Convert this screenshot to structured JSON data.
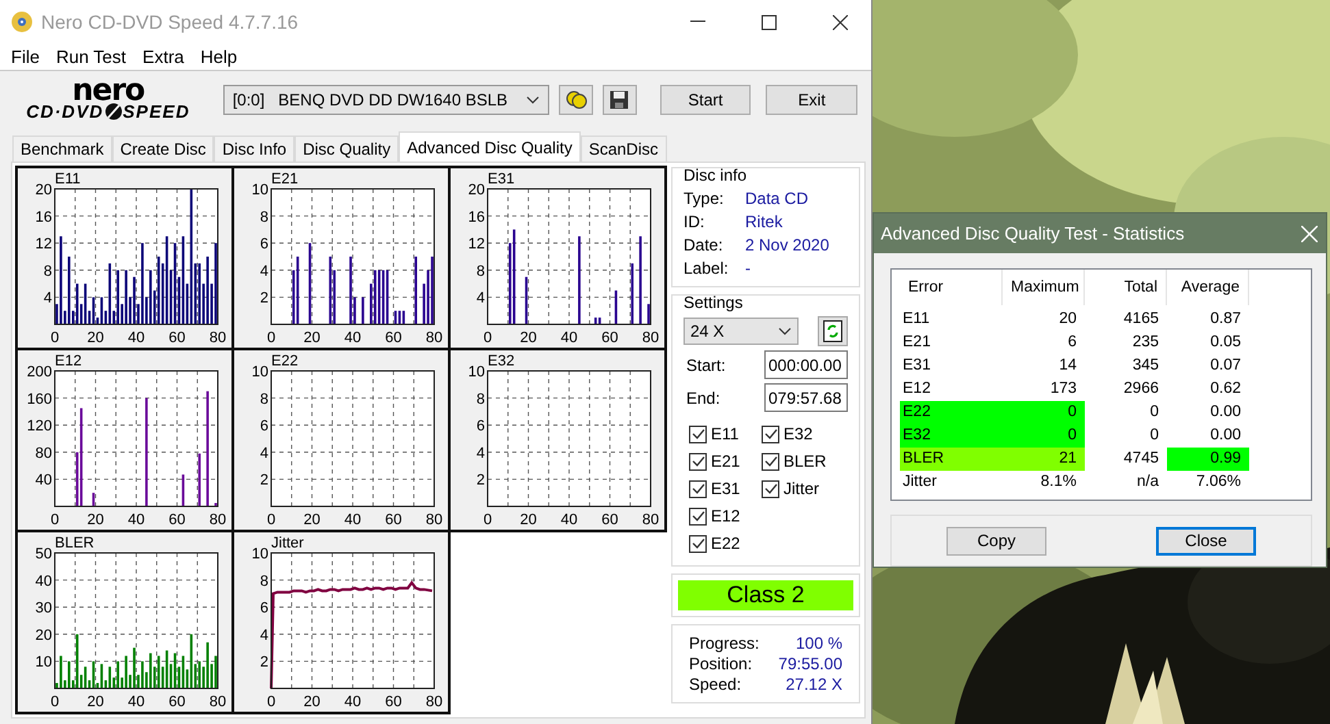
{
  "window": {
    "title": "Nero CD-DVD Speed 4.7.7.16"
  },
  "menu": [
    "File",
    "Run Test",
    "Extra",
    "Help"
  ],
  "toolbar": {
    "logo": {
      "top": "nero",
      "left": "CD·DVD",
      "right": "SPEED"
    },
    "drive": "[0:0]   BENQ DVD DD DW1640 BSLB",
    "buttons": [
      "Start",
      "Exit"
    ]
  },
  "tabs": [
    {
      "label": "Benchmark",
      "selected": false
    },
    {
      "label": "Create Disc",
      "selected": false
    },
    {
      "label": "Disc Info",
      "selected": false
    },
    {
      "label": "Disc Quality",
      "selected": false
    },
    {
      "label": "Advanced Disc Quality",
      "selected": true
    },
    {
      "label": "ScanDisc",
      "selected": false
    }
  ],
  "charts": [
    {
      "chart_data": {
        "type": "bar",
        "title": "E11",
        "grid": true,
        "x": [
          1,
          3,
          5,
          7,
          9,
          11,
          13,
          15,
          17,
          19,
          21,
          23,
          25,
          27,
          29,
          31,
          33,
          35,
          37,
          39,
          41,
          43,
          45,
          47,
          49,
          51,
          53,
          55,
          57,
          59,
          61,
          63,
          65,
          67,
          69,
          71,
          73,
          75,
          77,
          79
        ],
        "xlim": [
          0,
          80
        ],
        "ylim": [
          0,
          20
        ],
        "xticks": [
          0,
          20,
          40,
          60,
          80
        ],
        "yticks": [
          4,
          8,
          12,
          16,
          20
        ],
        "series": [
          {
            "color": "#0c0478",
            "values": [
              3,
              13,
              2,
              10,
              2,
              6,
              3,
              6,
              2,
              4,
              1,
              4,
              2,
              9,
              2,
              8,
              3,
              8,
              4,
              7,
              3,
              12,
              4,
              8,
              5,
              10,
              9,
              13,
              8,
              12,
              7,
              13,
              6,
              20,
              9,
              9,
              6,
              10,
              6,
              12
            ]
          }
        ]
      }
    },
    {
      "chart_data": {
        "type": "bar",
        "title": "E21",
        "grid": true,
        "x": [
          1,
          3,
          5,
          7,
          9,
          11,
          13,
          15,
          17,
          19,
          21,
          23,
          25,
          27,
          29,
          31,
          33,
          35,
          37,
          39,
          41,
          43,
          45,
          47,
          49,
          51,
          53,
          55,
          57,
          59,
          61,
          63,
          65,
          67,
          69,
          71,
          73,
          75,
          77,
          79
        ],
        "xlim": [
          0,
          80
        ],
        "ylim": [
          0,
          10
        ],
        "xticks": [
          0,
          20,
          40,
          60,
          80
        ],
        "yticks": [
          2,
          4,
          6,
          8,
          10
        ],
        "series": [
          {
            "color": "#2a0490",
            "values": [
              0,
              0,
              0,
              0,
              0,
              4,
              5,
              0,
              0,
              6,
              0,
              0,
              0,
              0,
              5,
              4,
              0,
              0,
              0,
              5,
              2,
              0,
              2,
              0,
              3,
              4,
              4,
              4,
              4,
              0,
              1,
              1,
              1,
              0,
              0,
              5,
              0,
              3,
              4,
              5
            ]
          }
        ]
      }
    },
    {
      "chart_data": {
        "type": "bar",
        "title": "E31",
        "grid": true,
        "x": [
          1,
          3,
          5,
          7,
          9,
          11,
          13,
          15,
          17,
          19,
          21,
          23,
          25,
          27,
          29,
          31,
          33,
          35,
          37,
          39,
          41,
          43,
          45,
          47,
          49,
          51,
          53,
          55,
          57,
          59,
          61,
          63,
          65,
          67,
          69,
          71,
          73,
          75,
          77,
          79
        ],
        "xlim": [
          0,
          80
        ],
        "ylim": [
          0,
          20
        ],
        "xticks": [
          0,
          20,
          40,
          60,
          80
        ],
        "yticks": [
          4,
          8,
          12,
          16,
          20
        ],
        "series": [
          {
            "color": "#2a0490",
            "values": [
              0,
              0,
              0,
              0,
              0,
              12,
              14,
              0,
              0,
              7,
              0,
              0,
              0,
              0,
              0,
              0,
              0,
              0,
              0,
              0,
              0,
              0,
              13,
              0,
              0,
              0,
              1,
              1,
              0,
              0,
              0,
              5,
              0,
              0,
              0,
              9,
              0,
              13,
              0,
              3
            ]
          }
        ]
      }
    },
    {
      "chart_data": {
        "type": "bar",
        "title": "E12",
        "grid": true,
        "x": [
          1,
          3,
          5,
          7,
          9,
          11,
          13,
          15,
          17,
          19,
          21,
          23,
          25,
          27,
          29,
          31,
          33,
          35,
          37,
          39,
          41,
          43,
          45,
          47,
          49,
          51,
          53,
          55,
          57,
          59,
          61,
          63,
          65,
          67,
          69,
          71,
          73,
          75,
          77,
          79
        ],
        "xlim": [
          0,
          80
        ],
        "ylim": [
          0,
          200
        ],
        "xticks": [
          0,
          20,
          40,
          60,
          80
        ],
        "yticks": [
          40,
          80,
          120,
          160,
          200
        ],
        "series": [
          {
            "color": "#6a0a9a",
            "values": [
              0,
              0,
              0,
              0,
              0,
              80,
              145,
              0,
              0,
              20,
              0,
              0,
              0,
              0,
              0,
              0,
              0,
              0,
              0,
              0,
              0,
              0,
              160,
              0,
              0,
              0,
              0,
              0,
              0,
              0,
              0,
              47,
              0,
              0,
              0,
              78,
              0,
              170,
              0,
              5
            ]
          }
        ]
      }
    },
    {
      "chart_data": {
        "type": "bar",
        "title": "E22",
        "grid": true,
        "x": [
          1,
          3,
          5,
          7,
          9,
          11,
          13,
          15,
          17,
          19,
          21,
          23,
          25,
          27,
          29,
          31,
          33,
          35,
          37,
          39,
          41,
          43,
          45,
          47,
          49,
          51,
          53,
          55,
          57,
          59,
          61,
          63,
          65,
          67,
          69,
          71,
          73,
          75,
          77,
          79
        ],
        "xlim": [
          0,
          80
        ],
        "ylim": [
          0,
          10
        ],
        "xticks": [
          0,
          20,
          40,
          60,
          80
        ],
        "yticks": [
          2,
          4,
          6,
          8,
          10
        ],
        "series": [
          {
            "values": [
              0,
              0,
              0,
              0,
              0,
              0,
              0,
              0,
              0,
              0,
              0,
              0,
              0,
              0,
              0,
              0,
              0,
              0,
              0,
              0,
              0,
              0,
              0,
              0,
              0,
              0,
              0,
              0,
              0,
              0,
              0,
              0,
              0,
              0,
              0,
              0,
              0,
              0,
              0,
              0
            ]
          }
        ]
      }
    },
    {
      "chart_data": {
        "type": "bar",
        "title": "E32",
        "grid": true,
        "x": [
          1,
          3,
          5,
          7,
          9,
          11,
          13,
          15,
          17,
          19,
          21,
          23,
          25,
          27,
          29,
          31,
          33,
          35,
          37,
          39,
          41,
          43,
          45,
          47,
          49,
          51,
          53,
          55,
          57,
          59,
          61,
          63,
          65,
          67,
          69,
          71,
          73,
          75,
          77,
          79
        ],
        "xlim": [
          0,
          80
        ],
        "ylim": [
          0,
          10
        ],
        "xticks": [
          0,
          20,
          40,
          60,
          80
        ],
        "yticks": [
          2,
          4,
          6,
          8,
          10
        ],
        "series": [
          {
            "values": [
              0,
              0,
              0,
              0,
              0,
              0,
              0,
              0,
              0,
              0,
              0,
              0,
              0,
              0,
              0,
              0,
              0,
              0,
              0,
              0,
              0,
              0,
              0,
              0,
              0,
              0,
              0,
              0,
              0,
              0,
              0,
              0,
              0,
              0,
              0,
              0,
              0,
              0,
              0,
              0
            ]
          }
        ]
      }
    },
    {
      "chart_data": {
        "type": "bar",
        "title": "BLER",
        "grid": true,
        "x": [
          1,
          3,
          5,
          7,
          9,
          11,
          13,
          15,
          17,
          19,
          21,
          23,
          25,
          27,
          29,
          31,
          33,
          35,
          37,
          39,
          41,
          43,
          45,
          47,
          49,
          51,
          53,
          55,
          57,
          59,
          61,
          63,
          65,
          67,
          69,
          71,
          73,
          75,
          77,
          79
        ],
        "xlim": [
          0,
          80
        ],
        "ylim": [
          0,
          50
        ],
        "xticks": [
          0,
          20,
          40,
          60,
          80
        ],
        "yticks": [
          10,
          20,
          30,
          40,
          50
        ],
        "series": [
          {
            "color": "#008000",
            "values": [
              2,
              12,
              3,
              10,
              3,
              20,
              5,
              8,
              3,
              10,
              2,
              9,
              3,
              8,
              4,
              10,
              4,
              12,
              5,
              15,
              5,
              10,
              6,
              13,
              8,
              12,
              8,
              14,
              9,
              13,
              8,
              12,
              7,
              20,
              9,
              10,
              8,
              17,
              9,
              12
            ]
          }
        ]
      }
    },
    {
      "chart_data": {
        "type": "line",
        "title": "Jitter",
        "grid": true,
        "x": [
          0,
          1,
          3,
          5,
          7,
          9,
          11,
          13,
          15,
          17,
          19,
          21,
          23,
          25,
          27,
          29,
          31,
          33,
          35,
          37,
          39,
          41,
          43,
          45,
          47,
          49,
          51,
          53,
          55,
          57,
          59,
          61,
          63,
          65,
          67,
          69,
          71,
          73,
          75,
          79
        ],
        "xlim": [
          0,
          80
        ],
        "ylim": [
          0,
          10
        ],
        "xticks": [
          0,
          20,
          40,
          60,
          80
        ],
        "yticks": [
          2,
          4,
          6,
          8,
          10
        ],
        "series": [
          {
            "color": "#800040",
            "values": [
              0,
              7,
              7.1,
              7.1,
              7.1,
              7.1,
              7.2,
              7.2,
              7.2,
              7.1,
              7.2,
              7.2,
              7.3,
              7.2,
              7.2,
              7.3,
              7.3,
              7.2,
              7.3,
              7.3,
              7.3,
              7.4,
              7.3,
              7.3,
              7.4,
              7.3,
              7.4,
              7.4,
              7.3,
              7.4,
              7.4,
              7.3,
              7.4,
              7.4,
              7.4,
              7.8,
              7.4,
              7.3,
              7.3,
              7.2
            ]
          }
        ]
      }
    }
  ],
  "disc_info": {
    "title": "Disc info",
    "rows": [
      {
        "label": "Type:",
        "value": "Data CD"
      },
      {
        "label": "ID:",
        "value": "Ritek"
      },
      {
        "label": "Date:",
        "value": "2 Nov 2020"
      },
      {
        "label": "Label:",
        "value": "-"
      }
    ]
  },
  "settings": {
    "title": "Settings",
    "speed": "24 X",
    "fields": [
      {
        "label": "Start:",
        "value": "000:00.00"
      },
      {
        "label": "End:",
        "value": "079:57.68"
      }
    ],
    "checks": [
      {
        "label": "E11",
        "checked": true
      },
      {
        "label": "E21",
        "checked": true
      },
      {
        "label": "E31",
        "checked": true
      },
      {
        "label": "E12",
        "checked": true
      },
      {
        "label": "E22",
        "checked": true
      },
      {
        "label": "E32",
        "checked": true
      },
      {
        "label": "BLER",
        "checked": true
      },
      {
        "label": "Jitter",
        "checked": true
      }
    ]
  },
  "class": {
    "label": "Class 2",
    "color": "#80ff00"
  },
  "progress": [
    {
      "label": "Progress:",
      "value": "100 %"
    },
    {
      "label": "Position:",
      "value": "79:55.00"
    },
    {
      "label": "Speed:",
      "value": "27.12 X"
    }
  ],
  "dialog": {
    "title": "Advanced Disc Quality Test - Statistics",
    "columns": [
      "Error",
      "Maximum",
      "Total",
      "Average"
    ],
    "rows": [
      {
        "cells": [
          {
            "text": "E11"
          },
          {
            "text": "20"
          },
          {
            "text": "4165"
          },
          {
            "text": "0.87"
          }
        ]
      },
      {
        "cells": [
          {
            "text": "E21"
          },
          {
            "text": "6"
          },
          {
            "text": "235"
          },
          {
            "text": "0.05"
          }
        ]
      },
      {
        "cells": [
          {
            "text": "E31"
          },
          {
            "text": "14"
          },
          {
            "text": "345"
          },
          {
            "text": "0.07"
          }
        ]
      },
      {
        "cells": [
          {
            "text": "E12"
          },
          {
            "text": "173"
          },
          {
            "text": "2966"
          },
          {
            "text": "0.62"
          }
        ]
      },
      {
        "cells": [
          {
            "text": "E22",
            "color": "#00ff00"
          },
          {
            "text": "0",
            "color": "#00ff00"
          },
          {
            "text": "0"
          },
          {
            "text": "0.00"
          }
        ]
      },
      {
        "cells": [
          {
            "text": "E32",
            "color": "#00ff00"
          },
          {
            "text": "0",
            "color": "#00ff00"
          },
          {
            "text": "0"
          },
          {
            "text": "0.00"
          }
        ]
      },
      {
        "cells": [
          {
            "text": "BLER",
            "color": "#80ff00"
          },
          {
            "text": "21",
            "color": "#80ff00"
          },
          {
            "text": "4745"
          },
          {
            "text": "0.99",
            "color": "#00ff00"
          }
        ]
      },
      {
        "cells": [
          {
            "text": "Jitter"
          },
          {
            "text": "8.1%"
          },
          {
            "text": "n/a"
          },
          {
            "text": "7.06%"
          }
        ]
      }
    ],
    "buttons": [
      {
        "label": "Copy",
        "focused": false
      },
      {
        "label": "Close",
        "focused": true
      }
    ]
  }
}
